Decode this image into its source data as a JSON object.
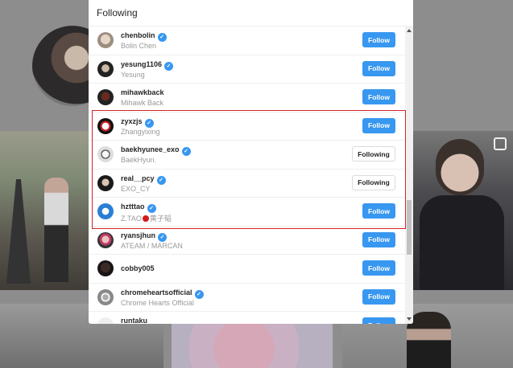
{
  "modal": {
    "title": "Following"
  },
  "accounts": [
    {
      "username": "chenbolin",
      "fullname": "Bolin Chen",
      "verified": true,
      "button": "Follow",
      "state": "follow"
    },
    {
      "username": "yesung1106",
      "fullname": "Yesung",
      "verified": true,
      "button": "Follow",
      "state": "follow"
    },
    {
      "username": "mihawkback",
      "fullname": "Mihawk Back",
      "verified": false,
      "button": "Follow",
      "state": "follow"
    },
    {
      "username": "zyxzjs",
      "fullname": "Zhangyixing",
      "verified": true,
      "button": "Follow",
      "state": "follow"
    },
    {
      "username": "baekhyunee_exo",
      "fullname": "BaekHyun.",
      "verified": true,
      "button": "Following",
      "state": "following"
    },
    {
      "username": "real__pcy",
      "fullname": "EXO_CY",
      "verified": true,
      "button": "Following",
      "state": "following"
    },
    {
      "username": "hztttao",
      "fullname_prefix": "Z.TAO",
      "fullname_suffix": "黄子韬",
      "verified": true,
      "button": "Follow",
      "state": "follow"
    },
    {
      "username": "ryansjhun",
      "fullname": "ATEAM / MARCAN",
      "verified": true,
      "button": "Follow",
      "state": "follow"
    },
    {
      "username": "cobby005",
      "fullname": "",
      "verified": false,
      "button": "Follow",
      "state": "follow"
    },
    {
      "username": "chromeheartsofficial",
      "fullname": "Chrome Hearts Official",
      "verified": true,
      "button": "Follow",
      "state": "follow"
    },
    {
      "username": "runtaku",
      "fullname": "",
      "verified": false,
      "button": "Follow",
      "state": "follow"
    }
  ],
  "badge_glyph": "✓",
  "colors": {
    "follow_button": "#3897f0",
    "highlight_box": "#d2242a",
    "verified_badge": "#3897f0"
  },
  "icons": {
    "verified": "verified-badge-icon",
    "scroll_up": "scroll-up-arrow-icon",
    "scroll_down": "scroll-down-arrow-icon"
  }
}
